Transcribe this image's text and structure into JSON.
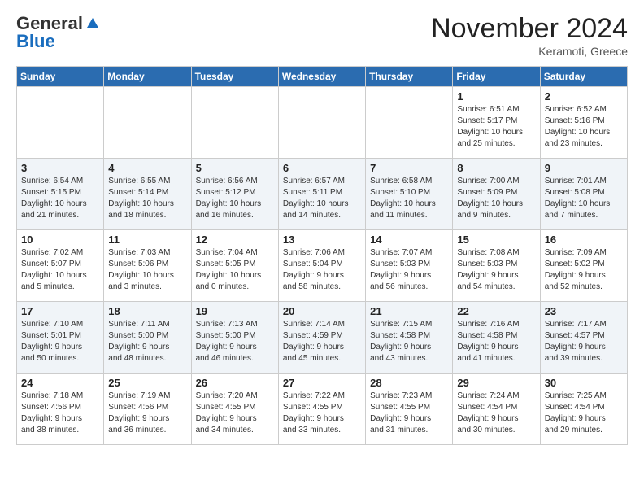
{
  "header": {
    "logo_general": "General",
    "logo_blue": "Blue",
    "month_title": "November 2024",
    "location": "Keramoti, Greece"
  },
  "weekdays": [
    "Sunday",
    "Monday",
    "Tuesday",
    "Wednesday",
    "Thursday",
    "Friday",
    "Saturday"
  ],
  "weeks": [
    [
      {
        "day": "",
        "info": ""
      },
      {
        "day": "",
        "info": ""
      },
      {
        "day": "",
        "info": ""
      },
      {
        "day": "",
        "info": ""
      },
      {
        "day": "",
        "info": ""
      },
      {
        "day": "1",
        "info": "Sunrise: 6:51 AM\nSunset: 5:17 PM\nDaylight: 10 hours\nand 25 minutes."
      },
      {
        "day": "2",
        "info": "Sunrise: 6:52 AM\nSunset: 5:16 PM\nDaylight: 10 hours\nand 23 minutes."
      }
    ],
    [
      {
        "day": "3",
        "info": "Sunrise: 6:54 AM\nSunset: 5:15 PM\nDaylight: 10 hours\nand 21 minutes."
      },
      {
        "day": "4",
        "info": "Sunrise: 6:55 AM\nSunset: 5:14 PM\nDaylight: 10 hours\nand 18 minutes."
      },
      {
        "day": "5",
        "info": "Sunrise: 6:56 AM\nSunset: 5:12 PM\nDaylight: 10 hours\nand 16 minutes."
      },
      {
        "day": "6",
        "info": "Sunrise: 6:57 AM\nSunset: 5:11 PM\nDaylight: 10 hours\nand 14 minutes."
      },
      {
        "day": "7",
        "info": "Sunrise: 6:58 AM\nSunset: 5:10 PM\nDaylight: 10 hours\nand 11 minutes."
      },
      {
        "day": "8",
        "info": "Sunrise: 7:00 AM\nSunset: 5:09 PM\nDaylight: 10 hours\nand 9 minutes."
      },
      {
        "day": "9",
        "info": "Sunrise: 7:01 AM\nSunset: 5:08 PM\nDaylight: 10 hours\nand 7 minutes."
      }
    ],
    [
      {
        "day": "10",
        "info": "Sunrise: 7:02 AM\nSunset: 5:07 PM\nDaylight: 10 hours\nand 5 minutes."
      },
      {
        "day": "11",
        "info": "Sunrise: 7:03 AM\nSunset: 5:06 PM\nDaylight: 10 hours\nand 3 minutes."
      },
      {
        "day": "12",
        "info": "Sunrise: 7:04 AM\nSunset: 5:05 PM\nDaylight: 10 hours\nand 0 minutes."
      },
      {
        "day": "13",
        "info": "Sunrise: 7:06 AM\nSunset: 5:04 PM\nDaylight: 9 hours\nand 58 minutes."
      },
      {
        "day": "14",
        "info": "Sunrise: 7:07 AM\nSunset: 5:03 PM\nDaylight: 9 hours\nand 56 minutes."
      },
      {
        "day": "15",
        "info": "Sunrise: 7:08 AM\nSunset: 5:03 PM\nDaylight: 9 hours\nand 54 minutes."
      },
      {
        "day": "16",
        "info": "Sunrise: 7:09 AM\nSunset: 5:02 PM\nDaylight: 9 hours\nand 52 minutes."
      }
    ],
    [
      {
        "day": "17",
        "info": "Sunrise: 7:10 AM\nSunset: 5:01 PM\nDaylight: 9 hours\nand 50 minutes."
      },
      {
        "day": "18",
        "info": "Sunrise: 7:11 AM\nSunset: 5:00 PM\nDaylight: 9 hours\nand 48 minutes."
      },
      {
        "day": "19",
        "info": "Sunrise: 7:13 AM\nSunset: 5:00 PM\nDaylight: 9 hours\nand 46 minutes."
      },
      {
        "day": "20",
        "info": "Sunrise: 7:14 AM\nSunset: 4:59 PM\nDaylight: 9 hours\nand 45 minutes."
      },
      {
        "day": "21",
        "info": "Sunrise: 7:15 AM\nSunset: 4:58 PM\nDaylight: 9 hours\nand 43 minutes."
      },
      {
        "day": "22",
        "info": "Sunrise: 7:16 AM\nSunset: 4:58 PM\nDaylight: 9 hours\nand 41 minutes."
      },
      {
        "day": "23",
        "info": "Sunrise: 7:17 AM\nSunset: 4:57 PM\nDaylight: 9 hours\nand 39 minutes."
      }
    ],
    [
      {
        "day": "24",
        "info": "Sunrise: 7:18 AM\nSunset: 4:56 PM\nDaylight: 9 hours\nand 38 minutes."
      },
      {
        "day": "25",
        "info": "Sunrise: 7:19 AM\nSunset: 4:56 PM\nDaylight: 9 hours\nand 36 minutes."
      },
      {
        "day": "26",
        "info": "Sunrise: 7:20 AM\nSunset: 4:55 PM\nDaylight: 9 hours\nand 34 minutes."
      },
      {
        "day": "27",
        "info": "Sunrise: 7:22 AM\nSunset: 4:55 PM\nDaylight: 9 hours\nand 33 minutes."
      },
      {
        "day": "28",
        "info": "Sunrise: 7:23 AM\nSunset: 4:55 PM\nDaylight: 9 hours\nand 31 minutes."
      },
      {
        "day": "29",
        "info": "Sunrise: 7:24 AM\nSunset: 4:54 PM\nDaylight: 9 hours\nand 30 minutes."
      },
      {
        "day": "30",
        "info": "Sunrise: 7:25 AM\nSunset: 4:54 PM\nDaylight: 9 hours\nand 29 minutes."
      }
    ]
  ]
}
